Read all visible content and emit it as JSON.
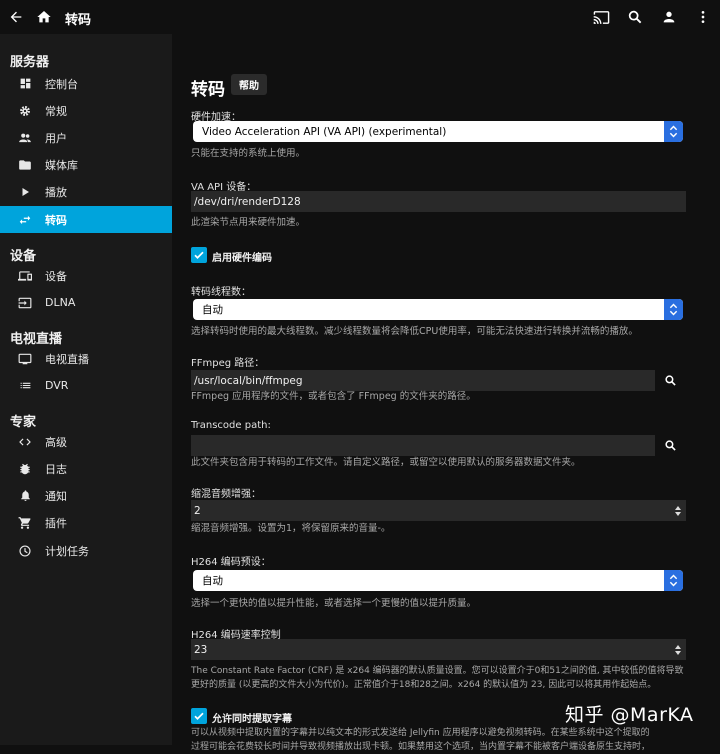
{
  "topbar": {
    "title": "转码",
    "back_icon": "arrow-left-icon",
    "home_icon": "home-icon",
    "actions": [
      "cast-icon",
      "search-icon",
      "user-icon",
      "menu-icon"
    ]
  },
  "sidebar": {
    "sections": [
      {
        "title": "服务器",
        "items": [
          {
            "label": "控制台",
            "icon": "dashboard-icon"
          },
          {
            "label": "常规",
            "icon": "gear-icon"
          },
          {
            "label": "用户",
            "icon": "people-icon"
          },
          {
            "label": "媒体库",
            "icon": "folder-icon"
          },
          {
            "label": "播放",
            "icon": "play-icon"
          },
          {
            "label": "转码",
            "icon": "transcode-icon",
            "active": true
          }
        ]
      },
      {
        "title": "设备",
        "items": [
          {
            "label": "设备",
            "icon": "devices-icon"
          },
          {
            "label": "DLNA",
            "icon": "input-icon"
          }
        ]
      },
      {
        "title": "电视直播",
        "items": [
          {
            "label": "电视直播",
            "icon": "tv-icon"
          },
          {
            "label": "DVR",
            "icon": "list-icon"
          }
        ]
      },
      {
        "title": "专家",
        "items": [
          {
            "label": "高级",
            "icon": "code-icon"
          },
          {
            "label": "日志",
            "icon": "bug-icon"
          },
          {
            "label": "通知",
            "icon": "bell-icon"
          },
          {
            "label": "插件",
            "icon": "cart-icon"
          },
          {
            "label": "计划任务",
            "icon": "clock-icon"
          }
        ]
      }
    ]
  },
  "main": {
    "title": "转码",
    "help_label": "帮助",
    "hw_accel": {
      "label": "硬件加速：",
      "value": "Video Acceleration API (VA API) (experimental)",
      "hint": "只能在支持的系统上使用。"
    },
    "vaapi_device": {
      "label": "VA API 设备：",
      "value": "/dev/dri/renderD128",
      "hint": "此渲染节点用来硬件加速。"
    },
    "enable_hw_encoding": {
      "label": "启用硬件编码",
      "checked": true
    },
    "thread_count": {
      "label": "转码线程数：",
      "value": "自动",
      "hint": "选择转码时使用的最大线程数。减少线程数量将会降低CPU使用率，可能无法快速进行转换并流畅的播放。"
    },
    "ffmpeg_path": {
      "label": "FFmpeg 路径：",
      "value": "/usr/local/bin/ffmpeg",
      "hint": "FFmpeg 应用程序的文件，或者包含了 FFmpeg 的文件夹的路径。"
    },
    "transcode_path": {
      "label": "Transcode path:",
      "value": "",
      "hint": "此文件夹包含用于转码的工作文件。请自定义路径，或留空以使用默认的服务器数据文件夹。"
    },
    "downmix_boost": {
      "label": "缩混音频增强：",
      "value": "2",
      "hint": "缩混音频增强。设置为1，将保留原来的音量-。"
    },
    "h264_preset": {
      "label": "H264 编码预设：",
      "value": "自动",
      "hint": "选择一个更快的值以提升性能，或者选择一个更慢的值以提升质量。"
    },
    "h264_crf": {
      "label": "H264 编码速率控制",
      "value": "23",
      "hint_line1": "The Constant Rate Factor (CRF) 是 x264 编码器的默认质量设置。您可以设置介于0和51之间的值, 其中较低的值将导致",
      "hint_line2": "更好的质量 (以更高的文件大小为代价)。正常值介于18和28之间。x264 的默认值为 23, 因此可以将其用作起始点。"
    },
    "extract_subs": {
      "label": "允许同时提取字幕",
      "checked": true,
      "hint_line1": "可以从视频中提取内置的字幕并以纯文本的形式发送给 Jellyfin 应用程序以避免视频转码。在某些系统中这个提取的",
      "hint_line2": "过程可能会花费较长时间并导致视频播放出现卡顿。如果禁用这个选项，当内置字幕不能被客户端设备原生支持时，"
    }
  },
  "watermark": "知乎 @MarKA",
  "colors": {
    "accent": "#00a4dc",
    "select_arrow": "#2a6fe0",
    "sidebar_bg": "#1a1a1a",
    "page_bg": "#101010"
  }
}
